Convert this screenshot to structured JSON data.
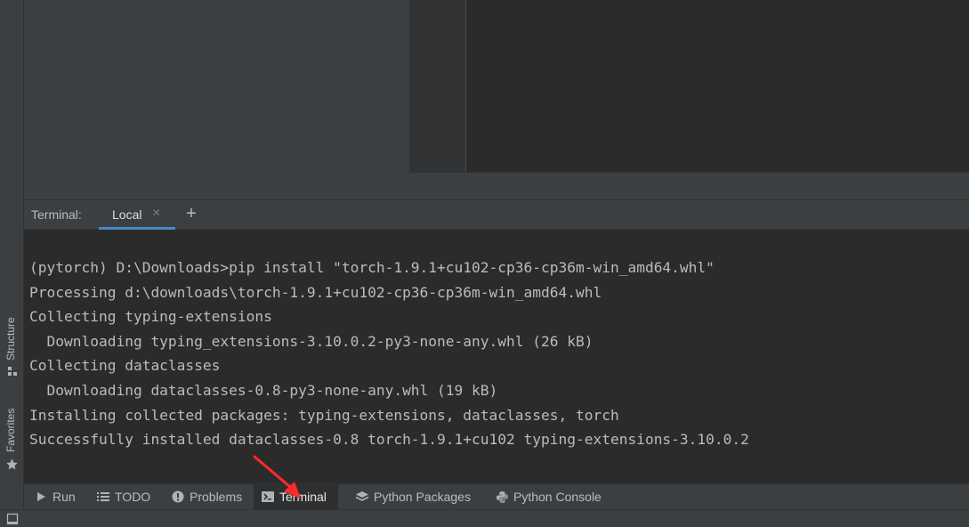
{
  "left_stripe": {
    "structure_label": "Structure",
    "favorites_label": "Favorites"
  },
  "terminal": {
    "title": "Terminal:",
    "tabs": [
      {
        "label": "Local",
        "close": "×"
      }
    ],
    "new_tab": "+",
    "lines": [
      "(pytorch) D:\\Downloads>pip install \"torch-1.9.1+cu102-cp36-cp36m-win_amd64.whl\"",
      "Processing d:\\downloads\\torch-1.9.1+cu102-cp36-cp36m-win_amd64.whl",
      "Collecting typing-extensions",
      "  Downloading typing_extensions-3.10.0.2-py3-none-any.whl (26 kB)",
      "Collecting dataclasses",
      "  Downloading dataclasses-0.8-py3-none-any.whl (19 kB)",
      "Installing collected packages: typing-extensions, dataclasses, torch",
      "Successfully installed dataclasses-0.8 torch-1.9.1+cu102 typing-extensions-3.10.0.2"
    ]
  },
  "tool_windows": [
    {
      "label": "Run",
      "icon": "play-icon"
    },
    {
      "label": "TODO",
      "icon": "list-icon"
    },
    {
      "label": "Problems",
      "icon": "warning-icon"
    },
    {
      "label": "Terminal",
      "icon": "terminal-icon",
      "active": true
    },
    {
      "label": "Python Packages",
      "icon": "layers-icon"
    },
    {
      "label": "Python Console",
      "icon": "python-icon"
    }
  ],
  "colors": {
    "background": "#2b2b2b",
    "panel": "#3c3f41",
    "text": "#bbbbbb",
    "tab_underline": "#4a88c7",
    "annotation": "#ff2a2a"
  }
}
